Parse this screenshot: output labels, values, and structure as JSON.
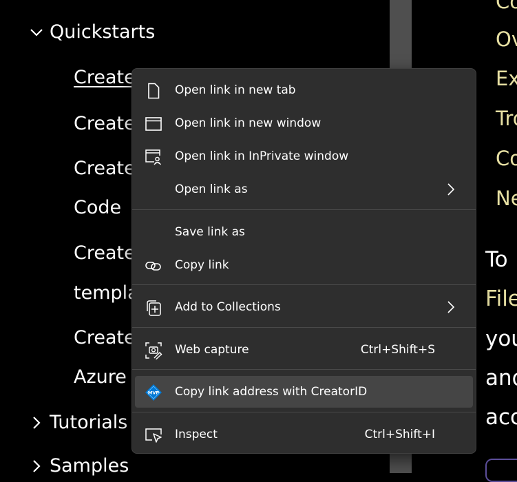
{
  "nav": {
    "sections": [
      {
        "label": "Quickstarts",
        "expanded": true
      },
      {
        "label": "Tutorials",
        "expanded": false
      },
      {
        "label": "Samples",
        "expanded": false
      }
    ],
    "links": [
      {
        "text": "Create"
      },
      {
        "text": "Create"
      },
      {
        "text": "Create"
      },
      {
        "text": "Code"
      },
      {
        "text": "Create"
      },
      {
        "text": "templa"
      },
      {
        "text": "Create"
      },
      {
        "text": "Azure"
      }
    ]
  },
  "content": {
    "toc": [
      "Co",
      "Ov",
      "Ex",
      "Tro",
      "Co",
      "Ne"
    ],
    "paragraph": {
      "line1": "To",
      "line2_link": "File",
      "line3": "you",
      "line4": "and",
      "line5": "acc"
    }
  },
  "context_menu": {
    "items": [
      {
        "label": "Open link in new tab",
        "icon": "new-tab-icon"
      },
      {
        "label": "Open link in new window",
        "icon": "new-window-icon"
      },
      {
        "label": "Open link in InPrivate window",
        "icon": "inprivate-window-icon"
      },
      {
        "label": "Open link as",
        "icon": "",
        "submenu": true
      },
      {
        "label": "Save link as",
        "icon": ""
      },
      {
        "label": "Copy link",
        "icon": "link-icon"
      },
      {
        "label": "Add to Collections",
        "icon": "collections-icon",
        "submenu": true
      },
      {
        "label": "Web capture",
        "icon": "web-capture-icon",
        "shortcut": "Ctrl+Shift+S"
      },
      {
        "label": "Copy link address with CreatorID",
        "icon": "mvp-icon",
        "highlighted": true
      },
      {
        "label": "Inspect",
        "icon": "inspect-icon",
        "shortcut": "Ctrl+Shift+I"
      }
    ]
  },
  "colors": {
    "menu_bg": "#2e2e2e",
    "menu_hover": "#454545",
    "link_yellow": "#e7e0a3",
    "mvp_blue": "#0078d4"
  }
}
